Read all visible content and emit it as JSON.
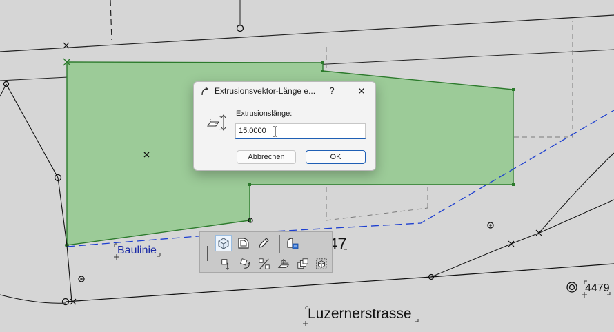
{
  "canvas": {
    "labels": {
      "baulinie": "Baulinie",
      "parcel_number_partial": "47",
      "parcel_number_right": "4479",
      "street": "Luzernerstrasse"
    },
    "colors": {
      "background": "#d6d6d6",
      "slab_fill": "#9ccb98",
      "slab_edge": "#2c7a2c",
      "baulinie_line": "#1d3fd0",
      "baulinie_text": "#1a2aa6",
      "survey_lines": "#1a1a1a",
      "hidden_lines": "#7a7a7a"
    }
  },
  "dialog": {
    "title": "Extrusionsvektor-Länge e...",
    "help_label": "?",
    "close_label": "✕",
    "field_label": "Extrusionslänge:",
    "field_value": "15.0000",
    "cancel_label": "Abbrechen",
    "ok_label": "OK",
    "icons": [
      "extrude-icon",
      "extrusion-length-icon",
      "text-cursor-icon"
    ]
  },
  "pet_palette": {
    "tools": [
      "solid-box-icon",
      "offset-edges-icon",
      "pencil-icon",
      "custom-settings-icon",
      "drag-icon",
      "rotate-icon",
      "mirror-icon",
      "elevate-icon",
      "multiply-icon",
      "select-elements-icon"
    ],
    "active_tool": "solid-box-icon"
  }
}
